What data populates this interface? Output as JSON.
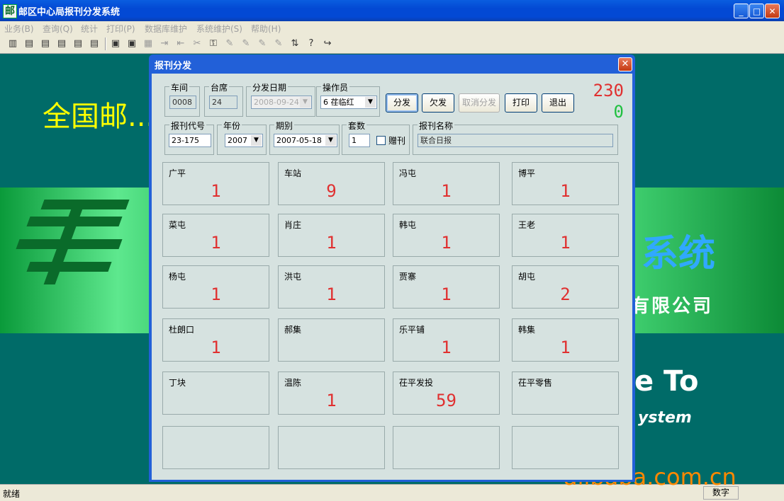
{
  "window": {
    "title": "邮区中心局报刊分发系统",
    "app_icon": "邮",
    "minimize_glyph": "_",
    "maximize_glyph": "□",
    "close_glyph": "✕"
  },
  "menu": [
    "业务(B)",
    "查询(Q)",
    "统计",
    "打印(P)",
    "数据库维护",
    "系统维护(S)",
    "帮助(H)"
  ],
  "toolbar": {
    "icons": [
      "books-icon",
      "doc-search-icon",
      "doc-search-icon",
      "doc-search-icon",
      "doc-search-icon",
      "doc-search-icon",
      "printer-icon",
      "printer-icon",
      "calculator-icon",
      "import-icon",
      "export-icon",
      "tools-icon",
      "key-icon",
      "edit-icon",
      "edit-icon",
      "edit-icon",
      "edit-icon",
      "split-icon",
      "help-icon",
      "exit-icon"
    ],
    "glyphs": [
      "▥",
      "▤",
      "▤",
      "▤",
      "▤",
      "▤",
      "▣",
      "▣",
      "▦",
      "⇥",
      "⇤",
      "✂",
      "⚿",
      "✎",
      "✎",
      "✎",
      "✎",
      "⇅",
      "?",
      "↪"
    ]
  },
  "background": {
    "cn_title": "全国邮...",
    "system": "系统",
    "company": "有限公司",
    "welcome": "e To",
    "system_en": "ystem"
  },
  "status": {
    "ready": "就绪",
    "numlock": "数字"
  },
  "watermark": "alibaba.com.cn",
  "dialog": {
    "title": "报刊分发",
    "close_glyph": "✕",
    "workshop": {
      "label": "车间",
      "value": "0008"
    },
    "station": {
      "label": "台席",
      "value": "24"
    },
    "date": {
      "label": "分发日期",
      "value": "2008-09-24"
    },
    "operator": {
      "label": "操作员",
      "value": "6  荏临红"
    },
    "buttons": {
      "distribute": "分发",
      "owe": "欠发",
      "cancel": "取消分发",
      "print": "打印",
      "exit": "退出"
    },
    "counter_total": "230",
    "counter_done": "0",
    "code": {
      "label": "报刊代号",
      "value": "23-175"
    },
    "year": {
      "label": "年份",
      "value": "2007"
    },
    "issue": {
      "label": "期别",
      "value": "2007-05-18"
    },
    "sets": {
      "label": "套数",
      "value": "1"
    },
    "gift": {
      "label": "赠刊"
    },
    "name": {
      "label": "报刊名称",
      "value": "联合日报"
    },
    "grid": [
      {
        "name": "广平",
        "count": "1"
      },
      {
        "name": "车站",
        "count": "9"
      },
      {
        "name": "冯屯",
        "count": "1"
      },
      {
        "name": "博平",
        "count": "1"
      },
      {
        "name": "菜屯",
        "count": "1"
      },
      {
        "name": "肖庄",
        "count": "1"
      },
      {
        "name": "韩屯",
        "count": "1"
      },
      {
        "name": "王老",
        "count": "1"
      },
      {
        "name": "杨屯",
        "count": "1"
      },
      {
        "name": "洪屯",
        "count": "1"
      },
      {
        "name": "贾寨",
        "count": "1"
      },
      {
        "name": "胡屯",
        "count": "2"
      },
      {
        "name": "杜朗口",
        "count": "1"
      },
      {
        "name": "郝集",
        "count": ""
      },
      {
        "name": "乐平铺",
        "count": "1"
      },
      {
        "name": "韩集",
        "count": "1"
      },
      {
        "name": "丁块",
        "count": ""
      },
      {
        "name": "温陈",
        "count": "1"
      },
      {
        "name": "茌平发投",
        "count": "59"
      },
      {
        "name": "茌平零售",
        "count": ""
      },
      {
        "name": "",
        "count": ""
      },
      {
        "name": "",
        "count": ""
      },
      {
        "name": "",
        "count": ""
      },
      {
        "name": "",
        "count": ""
      }
    ]
  },
  "colors": {
    "desktop": "#006b68",
    "titlebar": "#0349d4",
    "dialog_body": "#d6e2e0",
    "counter_total": "#e03030",
    "counter_done": "#20c040",
    "led": "#e03030"
  }
}
